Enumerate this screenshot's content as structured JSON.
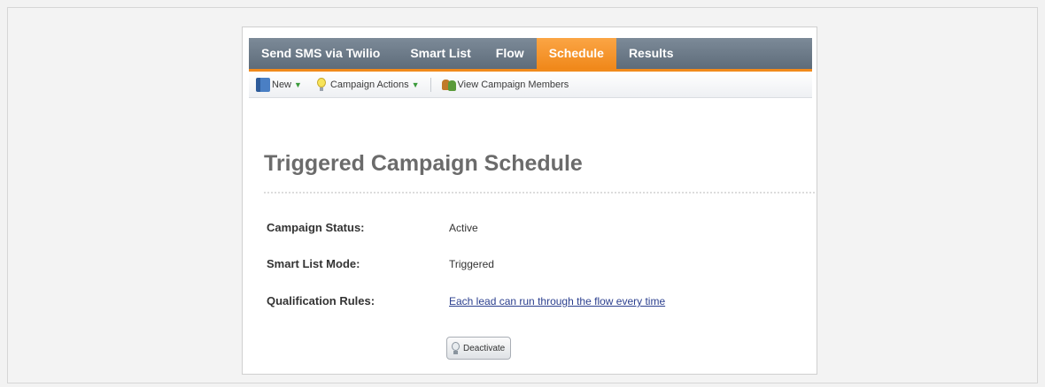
{
  "tabs": [
    {
      "label": "Send SMS via Twilio",
      "active": false
    },
    {
      "label": "Smart List",
      "active": false
    },
    {
      "label": "Flow",
      "active": false
    },
    {
      "label": "Schedule",
      "active": true
    },
    {
      "label": "Results",
      "active": false
    }
  ],
  "toolbar": {
    "new_label": "New",
    "campaign_actions_label": "Campaign Actions",
    "view_members_label": "View Campaign Members",
    "new_icon": "book-icon",
    "campaign_actions_icon": "bulb-icon",
    "view_members_icon": "people-icon"
  },
  "page": {
    "title": "Triggered Campaign Schedule"
  },
  "fields": [
    {
      "label": "Campaign Status:",
      "value": "Active",
      "is_link": false
    },
    {
      "label": "Smart List Mode:",
      "value": "Triggered",
      "is_link": false
    },
    {
      "label": "Qualification Rules:",
      "value": "Each lead can run through the flow every time",
      "is_link": true
    }
  ],
  "actions": {
    "deactivate_label": "Deactivate"
  },
  "colors": {
    "active_tab": "#f18a1c",
    "tabbar": "#6b7987",
    "link": "#2b3f8e",
    "title": "#6b6b6b"
  }
}
